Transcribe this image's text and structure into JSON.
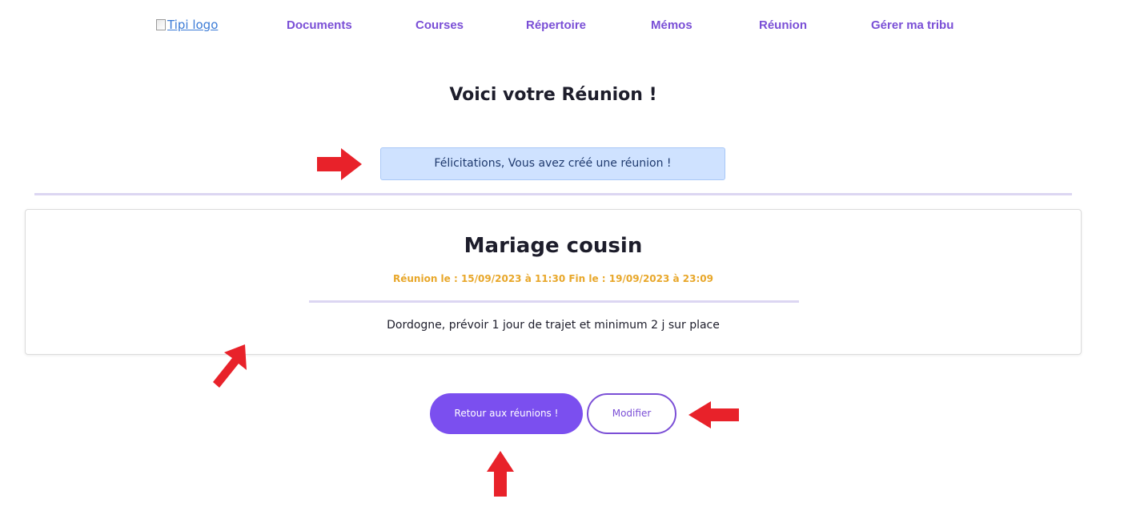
{
  "nav": {
    "logo_alt": "Tipi logo",
    "items": [
      {
        "label": "Documents"
      },
      {
        "label": "Courses"
      },
      {
        "label": "Répertoire"
      },
      {
        "label": "Mémos"
      },
      {
        "label": "Réunion"
      },
      {
        "label": "Gérer ma tribu"
      }
    ]
  },
  "page": {
    "title": "Voici votre Réunion !"
  },
  "alert": {
    "message": "Félicitations, Vous avez créé une réunion !"
  },
  "meeting": {
    "title": "Mariage cousin",
    "dates": "Réunion le : 15/09/2023 à 11:30 Fin le : 19/09/2023 à 23:09",
    "description": "Dordogne, prévoir 1 jour de trajet et minimum 2 j sur place"
  },
  "actions": {
    "back_label": "Retour aux réunions !",
    "edit_label": "Modifier"
  },
  "colors": {
    "accent": "#7b4fef",
    "nav_text": "#7a4fd6",
    "alert_bg": "#cfe2ff",
    "date_text": "#e8a72a",
    "annotation_arrow": "#e8222a"
  },
  "icons": {
    "logo": "broken-image-icon",
    "annotations": [
      "arrow-right-icon",
      "arrow-up-right-icon",
      "arrow-left-icon",
      "arrow-up-icon"
    ]
  }
}
